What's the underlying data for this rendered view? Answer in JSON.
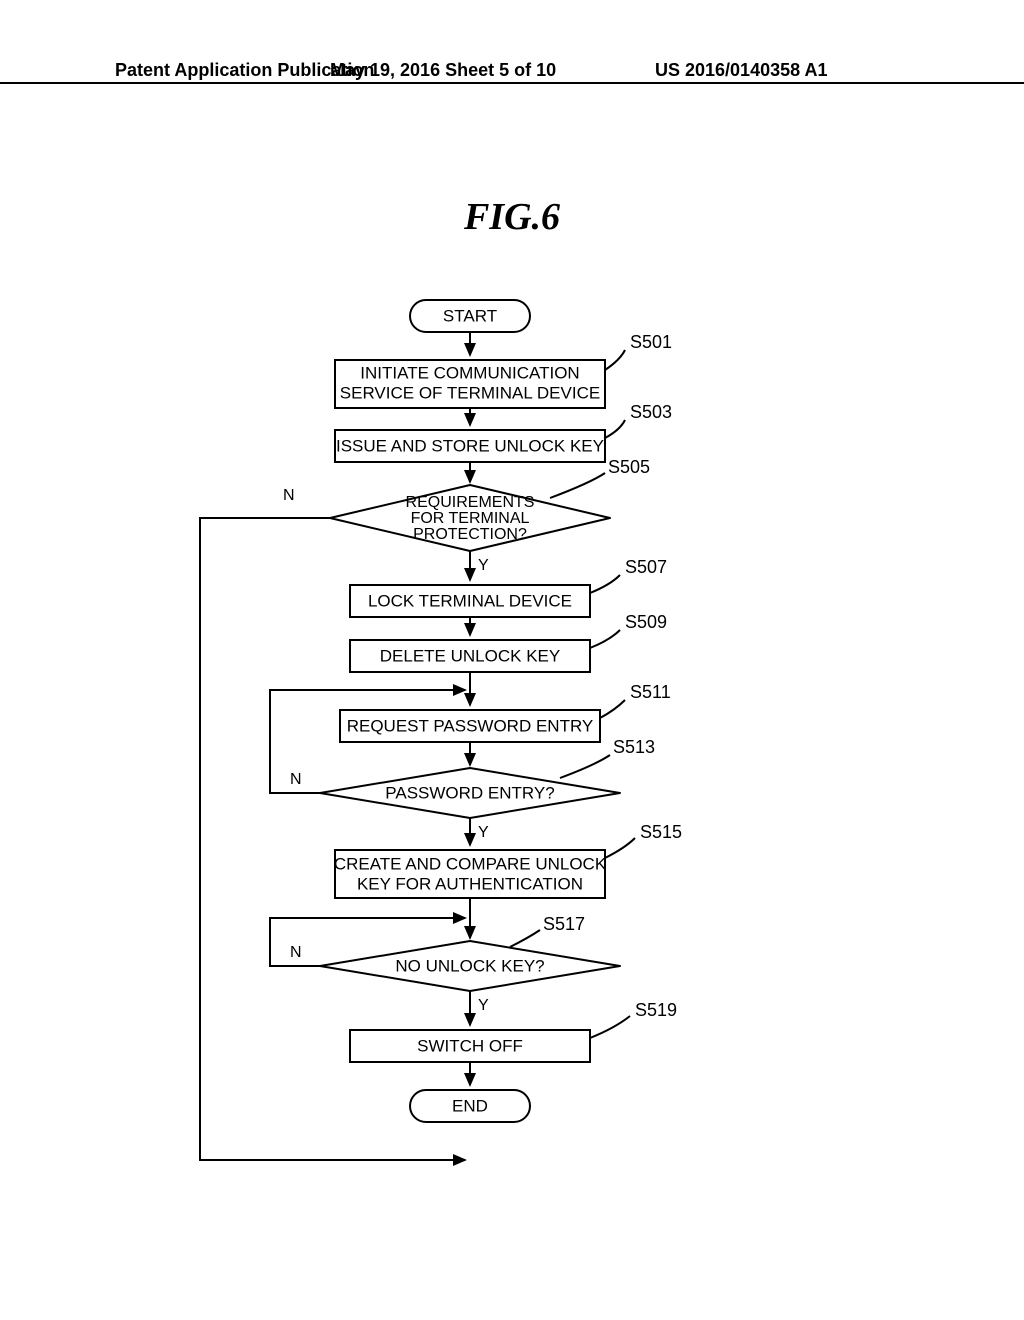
{
  "header": {
    "left": "Patent Application Publication",
    "mid": "May 19, 2016  Sheet 5 of 10",
    "right": "US 2016/0140358 A1"
  },
  "figure_caption": "FIG.6",
  "flow": {
    "start": "START",
    "end": "END",
    "s501": {
      "ref": "S501",
      "line1": "INITIATE COMMUNICATION",
      "line2": "SERVICE OF TERMINAL DEVICE"
    },
    "s503": {
      "ref": "S503",
      "text": "ISSUE AND STORE UNLOCK KEY"
    },
    "s505": {
      "ref": "S505",
      "line1": "REQUIREMENTS",
      "line2": "FOR TERMINAL",
      "line3": "PROTECTION?"
    },
    "s507": {
      "ref": "S507",
      "text": "LOCK TERMINAL DEVICE"
    },
    "s509": {
      "ref": "S509",
      "text": "DELETE UNLOCK KEY"
    },
    "s511": {
      "ref": "S511",
      "text": "REQUEST PASSWORD ENTRY"
    },
    "s513": {
      "ref": "S513",
      "text": "PASSWORD ENTRY?"
    },
    "s515": {
      "ref": "S515",
      "line1": "CREATE AND COMPARE UNLOCK",
      "line2": "KEY FOR AUTHENTICATION"
    },
    "s517": {
      "ref": "S517",
      "text": "NO UNLOCK KEY?"
    },
    "s519": {
      "ref": "S519",
      "text": "SWITCH OFF"
    },
    "yes": "Y",
    "no": "N"
  }
}
